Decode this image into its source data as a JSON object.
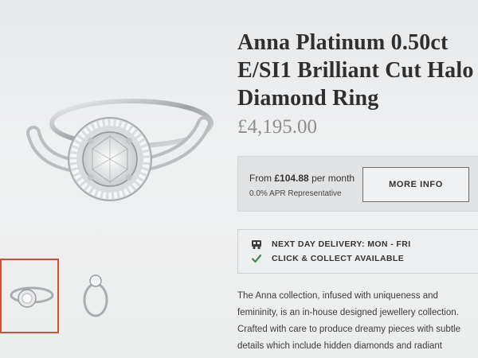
{
  "product": {
    "title": "Anna Platinum 0.50ct E/SI1 Brilliant Cut Halo Diamond Ring",
    "price": "£4,195.00"
  },
  "finance": {
    "from_prefix": "From ",
    "monthly_amount": "£104.88",
    "from_suffix": " per month",
    "apr": "0.0% APR Representative",
    "more_info_label": "MORE INFO"
  },
  "delivery": {
    "next_day": "NEXT DAY DELIVERY: MON - FRI",
    "click_collect": "CLICK & COLLECT AVAILABLE"
  },
  "description": "The Anna collection, infused with uniqueness and femininity, is an in-house designed jewellery collection. Crafted with care to produce dreamy pieces with subtle details which include hidden diamonds and radiant diamond halos, all",
  "colors": {
    "thumb_active_border": "#c9503f",
    "check_green": "#3e8e53",
    "price_grey": "#8e8e8e"
  },
  "icons": {
    "delivery": "truck-icon",
    "collect": "checkmark-icon"
  }
}
